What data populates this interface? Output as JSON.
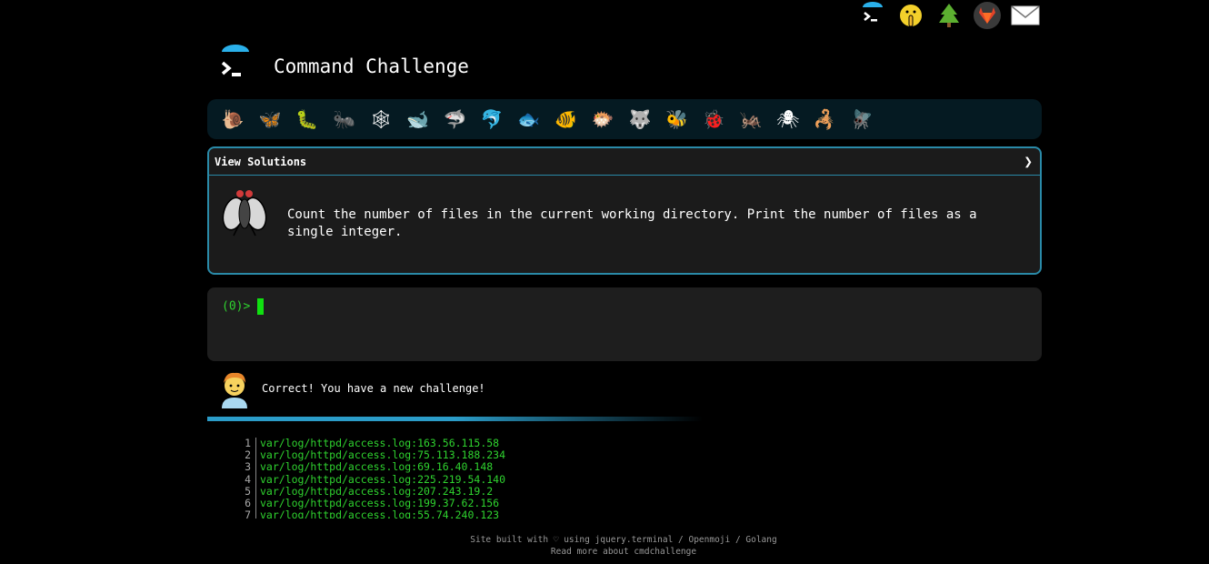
{
  "top_icons": [
    {
      "name": "terminal-logo-icon"
    },
    {
      "name": "shushing-face-icon"
    },
    {
      "name": "tree-icon"
    },
    {
      "name": "gitlab-icon"
    },
    {
      "name": "mail-icon"
    }
  ],
  "header": {
    "title": "Command Challenge"
  },
  "nav": {
    "items": [
      {
        "name": "snail-icon",
        "glyph": "🐌"
      },
      {
        "name": "butterfly-icon",
        "glyph": "🦋"
      },
      {
        "name": "caterpillar-icon",
        "glyph": "🐛"
      },
      {
        "name": "ant-icon",
        "glyph": "🐜"
      },
      {
        "name": "spider-web-icon",
        "glyph": "🕸"
      },
      {
        "name": "whale-icon",
        "glyph": "🐋"
      },
      {
        "name": "shark-icon",
        "glyph": "🦈"
      },
      {
        "name": "dolphin-icon",
        "glyph": "🐬"
      },
      {
        "name": "fish-icon",
        "glyph": "🐟"
      },
      {
        "name": "tropical-fish-icon",
        "glyph": "🐠"
      },
      {
        "name": "blowfish-icon",
        "glyph": "🐡"
      },
      {
        "name": "wolf-icon",
        "glyph": "🐺"
      },
      {
        "name": "bee-icon",
        "glyph": "🐝"
      },
      {
        "name": "ladybug-icon",
        "glyph": "🐞"
      },
      {
        "name": "cricket-icon",
        "glyph": "🦗"
      },
      {
        "name": "spider-icon",
        "glyph": "🕷"
      },
      {
        "name": "scorpion-icon",
        "glyph": "🦂"
      },
      {
        "name": "fly-icon",
        "glyph": "🪰"
      }
    ]
  },
  "panel": {
    "header": "View Solutions",
    "chevron": "❯",
    "challenge": "Count the number of files in the current working directory. Print the number of files as a single integer."
  },
  "terminal": {
    "prompt": "(0)>"
  },
  "message": {
    "text": "Correct! You have a new challenge!"
  },
  "code": [
    {
      "n": "1",
      "text": "var/log/httpd/access.log:163.56.115.58"
    },
    {
      "n": "2",
      "text": "var/log/httpd/access.log:75.113.188.234"
    },
    {
      "n": "3",
      "text": "var/log/httpd/access.log:69.16.40.148"
    },
    {
      "n": "4",
      "text": "var/log/httpd/access.log:225.219.54.140"
    },
    {
      "n": "5",
      "text": "var/log/httpd/access.log:207.243.19.2"
    },
    {
      "n": "6",
      "text": "var/log/httpd/access.log:199.37.62.156"
    },
    {
      "n": "7",
      "text": "var/log/httpd/access.log:55.74.240.123"
    }
  ],
  "footer": {
    "line1": "Site built with ♡ using jquery.terminal / Openmoji / Golang",
    "line2": "Read more about cmdchallenge"
  },
  "colors": {
    "accent": "#2a8aa8",
    "prompt_green": "#2fd32f",
    "nav_bg": "#051a22"
  }
}
